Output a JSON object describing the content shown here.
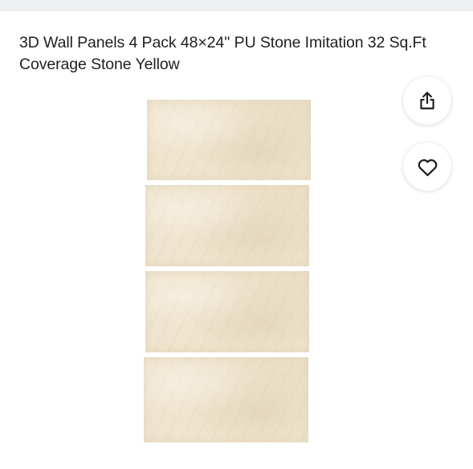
{
  "product": {
    "title": "3D Wall Panels 4 Pack 48×24'' PU Stone Imitation 32 Sq.Ft Coverage Stone Yellow"
  },
  "gallery": {
    "panel_count": 4,
    "panel_color": "#efe4cd"
  },
  "actions": {
    "share_icon": "share-icon",
    "favorite_icon": "heart-icon"
  },
  "colors": {
    "top_band": "#eef0f3",
    "text": "#1f1f1f",
    "icon": "#1f1f1f"
  }
}
